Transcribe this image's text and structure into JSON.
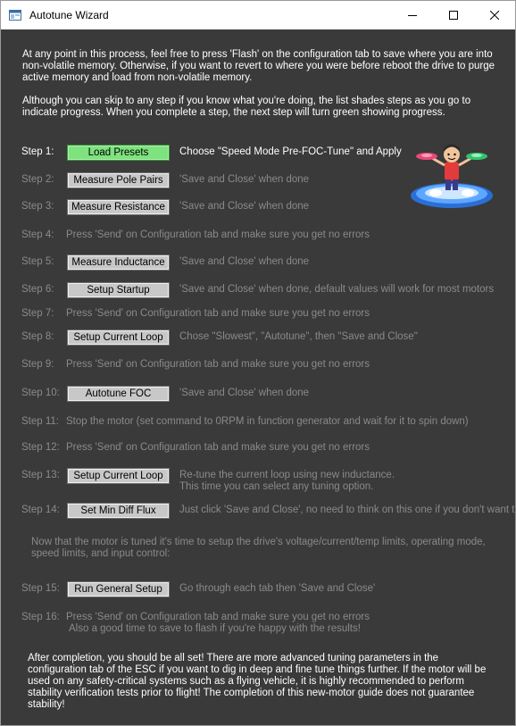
{
  "window": {
    "title": "Autotune Wizard",
    "min_icon": "minimize-icon",
    "max_icon": "maximize-icon",
    "close_icon": "close-icon"
  },
  "intro": {
    "p1": "At any point in this process, feel free to press 'Flash' on the configuration tab to save where you are into non-volatile memory. Otherwise, if you want to revert to where you were before reboot the drive to purge active memory and load from non-volatile memory.",
    "p2": "Although you can skip to any step if you know what you're doing, the list shades steps as you go to indicate progress. When you complete a step, the next step will turn green showing progress."
  },
  "steps": [
    {
      "label": "Step 1:",
      "button": "Load Presets",
      "desc": "Choose \"Speed Mode Pre-FOC-Tune\" and Apply"
    },
    {
      "label": "Step 2:",
      "button": "Measure Pole Pairs",
      "desc": "'Save and Close' when done"
    },
    {
      "label": "Step 3:",
      "button": "Measure Resistance",
      "desc": "'Save and Close' when done"
    },
    {
      "label": "Step 4:",
      "desc": "Press 'Send' on Configuration tab and make sure you get no errors"
    },
    {
      "label": "Step 5:",
      "button": "Measure Inductance",
      "desc": "'Save and Close' when done"
    },
    {
      "label": "Step 6:",
      "button": "Setup Startup",
      "desc": "'Save and Close' when done, default values will work for most motors"
    },
    {
      "label": "Step 7:",
      "desc": "Press 'Send' on Configuration tab and make sure you get no errors"
    },
    {
      "label": "Step 8:",
      "button": "Setup Current Loop",
      "desc": "Chose \"Slowest\", \"Autotune\", then \"Save and Close\""
    },
    {
      "label": "Step 9:",
      "desc": "Press 'Send' on Configuration tab and make sure you get no errors"
    },
    {
      "label": "Step 10:",
      "button": "Autotune FOC",
      "desc": "'Save and Close' when done"
    },
    {
      "label": "Step 11:",
      "desc": "Stop the motor (set command to 0RPM in function generator and wait for it to spin down)"
    },
    {
      "label": "Step 12:",
      "desc": "Press 'Send' on Configuration tab and make sure you get no errors"
    },
    {
      "label": "Step 13:",
      "button": "Setup Current Loop",
      "desc": "Re-tune the current loop using new inductance.",
      "desc2": "This time you can select any tuning option."
    },
    {
      "label": "Step 14:",
      "button": "Set Min Diff Flux",
      "desc": "Just click 'Save and Close', no need to think on this one if you don't want to."
    },
    {
      "label": "Step 15:",
      "button": "Run General Setup",
      "desc": "Go through each tab then 'Save and Close'"
    },
    {
      "label": "Step 16:",
      "desc": "Press 'Send' on Configuration tab and make sure you get no errors",
      "desc2": "Also a good time to save to flash if you're happy with the results!"
    }
  ],
  "midnote": "Now that the motor is tuned it's time to setup the drive's voltage/current/temp limits, operating mode, speed limits, and input control:",
  "outro": "After completion, you should be all set! There are more advanced tuning parameters in the configuration tab of the ESC if you want to dig in deep and fine tune things further. If the motor will be used on any safety-critical systems such as a flying vehicle, it is highly recommended to perform stability verification tests prior to flight! The completion of this new-motor guide does not guarantee stability!",
  "colors": {
    "background": "#3a3a3a",
    "active_text": "#ffffff",
    "inactive_text": "#8a8a8a",
    "active_button": "#7ee27e",
    "button": "#c8c8c8"
  }
}
